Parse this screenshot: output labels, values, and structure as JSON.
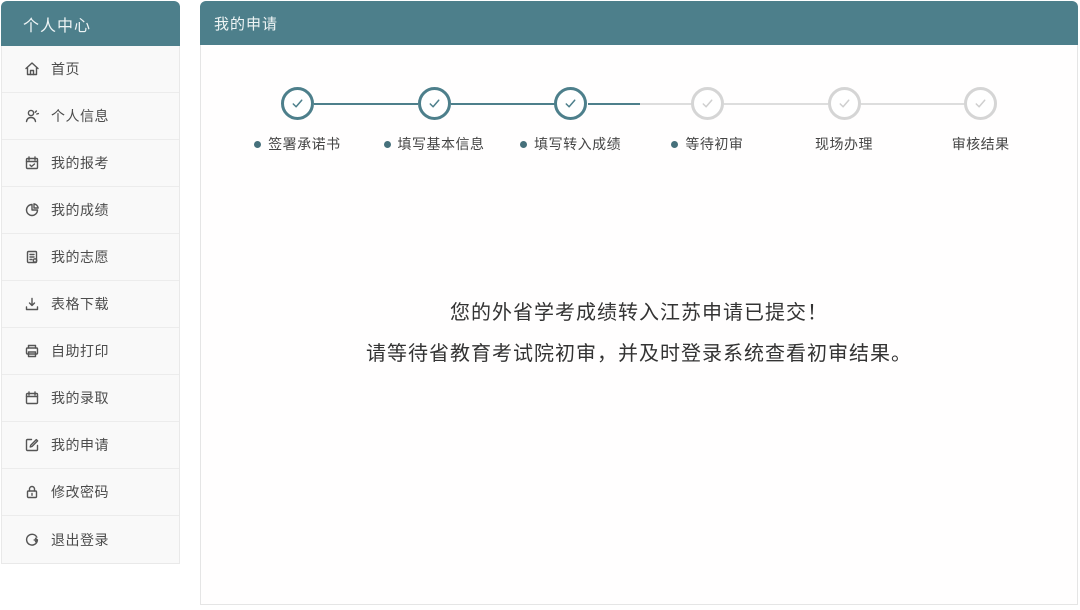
{
  "colors": {
    "accent_teal": "#4d7f8b",
    "done_circle": "#4d7f8b",
    "pending_circle": "#d5d5d5",
    "connector_gray": "#dddddd",
    "sidebar_item_bg": "#f9f9f9"
  },
  "sidebar": {
    "title": "个人中心",
    "items": [
      {
        "label": "首页",
        "icon": "home-icon"
      },
      {
        "label": "个人信息",
        "icon": "user-icon"
      },
      {
        "label": "我的报考",
        "icon": "calendar-check-icon"
      },
      {
        "label": "我的成绩",
        "icon": "pie-chart-icon"
      },
      {
        "label": "我的志愿",
        "icon": "clipboard-icon"
      },
      {
        "label": "表格下载",
        "icon": "download-icon"
      },
      {
        "label": "自助打印",
        "icon": "printer-icon"
      },
      {
        "label": "我的录取",
        "icon": "calendar-icon"
      },
      {
        "label": "我的申请",
        "icon": "edit-icon"
      },
      {
        "label": "修改密码",
        "icon": "lock-icon"
      },
      {
        "label": "退出登录",
        "icon": "logout-icon"
      }
    ],
    "active_item": "我的申请"
  },
  "main": {
    "title": "我的申请",
    "steps": [
      {
        "label": "签署承诺书",
        "status": "done",
        "dot": true
      },
      {
        "label": "填写基本信息",
        "status": "done",
        "dot": true
      },
      {
        "label": "填写转入成绩",
        "status": "done",
        "dot": true
      },
      {
        "label": "等待初审",
        "status": "pending",
        "dot": true
      },
      {
        "label": "现场办理",
        "status": "pending",
        "dot": false
      },
      {
        "label": "审核结果",
        "status": "pending",
        "dot": false
      }
    ],
    "message": {
      "line1": "您的外省学考成绩转入江苏申请已提交！",
      "line2": "请等待省教育考试院初审，并及时登录系统查看初审结果。"
    }
  }
}
